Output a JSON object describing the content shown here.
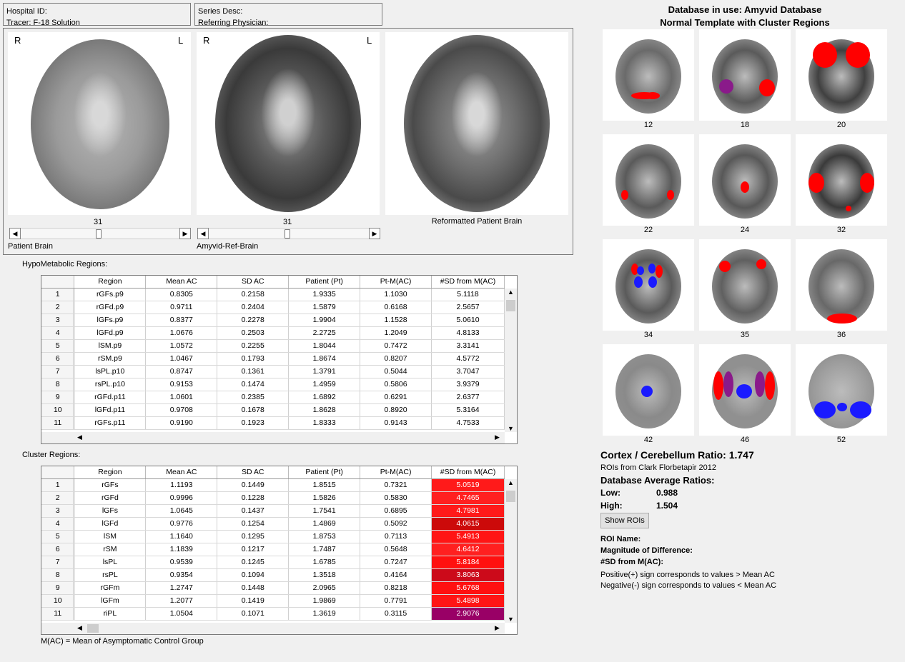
{
  "header": {
    "hospital_id": "Hospital ID:",
    "tracer": "Tracer: F-18 Solution",
    "series_desc": "Series Desc:",
    "referring": "Referring Physician:"
  },
  "views": {
    "r": "R",
    "l": "L",
    "slice1": "31",
    "slice2": "31",
    "patient_label": "Patient Brain",
    "ref_label": "Amyvid-Ref-Brain",
    "reformatted_label": "Reformatted Patient Brain",
    "slider1_pos": 0.47,
    "slider2_pos": 0.47
  },
  "hypo": {
    "title": "HypoMetabolic Regions:",
    "columns": [
      "Region",
      "Mean AC",
      "SD AC",
      "Patient (Pt)",
      "Pt-M(AC)",
      "#SD from M(AC)"
    ],
    "rows": [
      [
        "1",
        "rGFs.p9",
        "0.8305",
        "0.2158",
        "1.9335",
        "1.1030",
        "5.1118"
      ],
      [
        "2",
        "rGFd.p9",
        "0.9711",
        "0.2404",
        "1.5879",
        "0.6168",
        "2.5657"
      ],
      [
        "3",
        "lGFs.p9",
        "0.8377",
        "0.2278",
        "1.9904",
        "1.1528",
        "5.0610"
      ],
      [
        "4",
        "lGFd.p9",
        "1.0676",
        "0.2503",
        "2.2725",
        "1.2049",
        "4.8133"
      ],
      [
        "5",
        "lSM.p9",
        "1.0572",
        "0.2255",
        "1.8044",
        "0.7472",
        "3.3141"
      ],
      [
        "6",
        "rSM.p9",
        "1.0467",
        "0.1793",
        "1.8674",
        "0.8207",
        "4.5772"
      ],
      [
        "7",
        "lsPL.p10",
        "0.8747",
        "0.1361",
        "1.3791",
        "0.5044",
        "3.7047"
      ],
      [
        "8",
        "rsPL.p10",
        "0.9153",
        "0.1474",
        "1.4959",
        "0.5806",
        "3.9379"
      ],
      [
        "9",
        "rGFd.p11",
        "1.0601",
        "0.2385",
        "1.6892",
        "0.6291",
        "2.6377"
      ],
      [
        "10",
        "lGFd.p11",
        "0.9708",
        "0.1678",
        "1.8628",
        "0.8920",
        "5.3164"
      ],
      [
        "11",
        "rGFs.p11",
        "0.9190",
        "0.1923",
        "1.8333",
        "0.9143",
        "4.7533"
      ]
    ]
  },
  "cluster": {
    "title": "Cluster Regions:",
    "columns": [
      "Region",
      "Mean AC",
      "SD AC",
      "Patient (Pt)",
      "Pt-M(AC)",
      "#SD from M(AC)"
    ],
    "rows": [
      [
        "1",
        "rGFs",
        "1.1193",
        "0.1449",
        "1.8515",
        "0.7321",
        "5.0519"
      ],
      [
        "2",
        "rGFd",
        "0.9996",
        "0.1228",
        "1.5826",
        "0.5830",
        "4.7465"
      ],
      [
        "3",
        "lGFs",
        "1.0645",
        "0.1437",
        "1.7541",
        "0.6895",
        "4.7981"
      ],
      [
        "4",
        "lGFd",
        "0.9776",
        "0.1254",
        "1.4869",
        "0.5092",
        "4.0615"
      ],
      [
        "5",
        "lSM",
        "1.1640",
        "0.1295",
        "1.8753",
        "0.7113",
        "5.4913"
      ],
      [
        "6",
        "rSM",
        "1.1839",
        "0.1217",
        "1.7487",
        "0.5648",
        "4.6412"
      ],
      [
        "7",
        "lsPL",
        "0.9539",
        "0.1245",
        "1.6785",
        "0.7247",
        "5.8184"
      ],
      [
        "8",
        "rsPL",
        "0.9354",
        "0.1094",
        "1.3518",
        "0.4164",
        "3.8063"
      ],
      [
        "9",
        "rGFm",
        "1.2747",
        "0.1448",
        "2.0965",
        "0.8218",
        "5.6768"
      ],
      [
        "10",
        "lGFm",
        "1.2077",
        "0.1419",
        "1.9869",
        "0.7791",
        "5.4898"
      ],
      [
        "11",
        "riPL",
        "1.0504",
        "0.1071",
        "1.3619",
        "0.3115",
        "2.9076"
      ]
    ],
    "sd_colors": [
      "#ff1a1a",
      "#ff2020",
      "#ff1a1a",
      "#cc0a0a",
      "#ff1515",
      "#ff2020",
      "#ff1010",
      "#cc0a1a",
      "#ff1010",
      "#ff1515",
      "#990066"
    ],
    "footnote": "M(AC) = Mean of Asymptomatic Control Group"
  },
  "database": {
    "line1": "Database in use: Amyvid Database",
    "line2": "Normal Template with Cluster Regions",
    "slices": [
      "12",
      "18",
      "20",
      "22",
      "24",
      "32",
      "34",
      "35",
      "36",
      "42",
      "46",
      "52"
    ]
  },
  "results": {
    "ratio_label": "Cortex / Cerebellum Ratio:",
    "ratio_value": "1.747",
    "rois_from": "ROIs from Clark Florbetapir 2012",
    "db_avg": "Database Average Ratios:",
    "low_label": "Low:",
    "low_value": "0.988",
    "high_label": "High:",
    "high_value": "1.504",
    "show_rois": "Show ROIs",
    "roi_name": "ROI Name:",
    "magnitude": "Magnitude of Difference:",
    "sd_from": "#SD from M(AC):",
    "positive": "Positive(+) sign corresponds to values > Mean AC",
    "negative": "Negative(-) sign corresponds to values < Mean AC"
  },
  "colors": {
    "roi_red": "#ff0000",
    "roi_blue": "#1a1aff",
    "roi_purple": "#8a1a8a"
  }
}
